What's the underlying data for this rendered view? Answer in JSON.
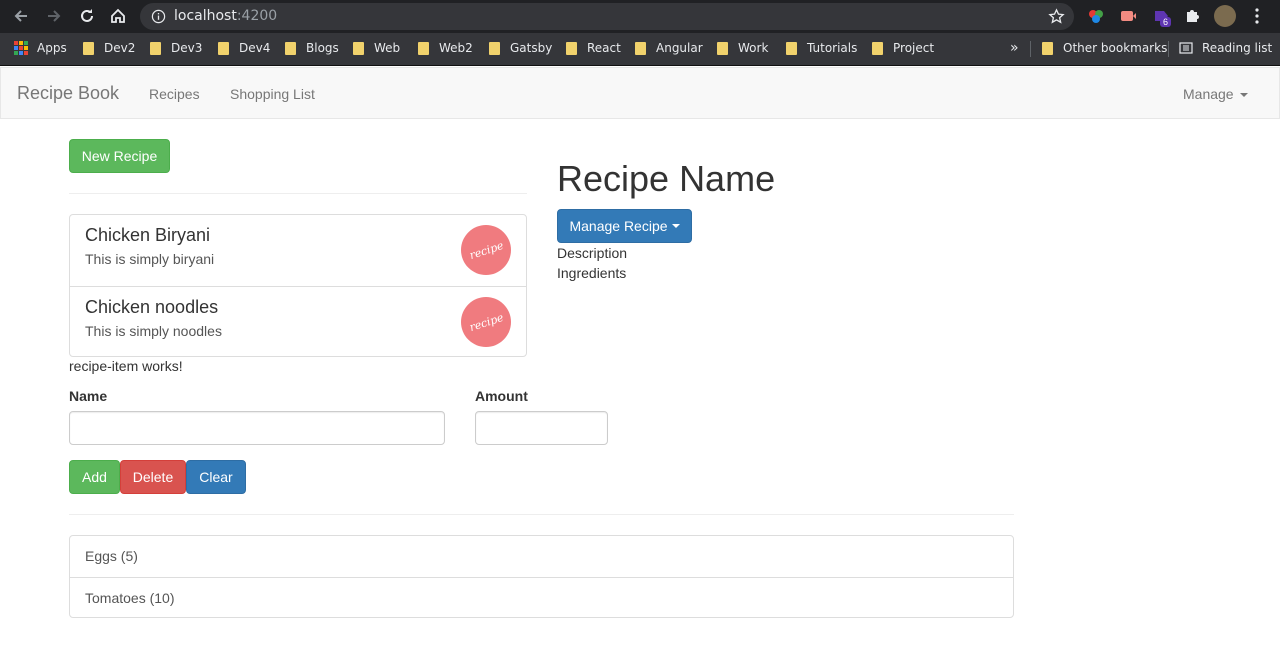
{
  "browser": {
    "url_host": "localhost",
    "url_port": ":4200",
    "bookmarks": [
      "Apps",
      "Dev2",
      "Dev3",
      "Dev4",
      "Blogs",
      "Web",
      "Web2",
      "Gatsby",
      "React",
      "Angular",
      "Work",
      "Tutorials",
      "Project"
    ],
    "overflow": "»",
    "other_bookmarks": "Other bookmarks",
    "reading_list": "Reading list",
    "extension_badge": "6"
  },
  "navbar": {
    "brand": "Recipe Book",
    "links": [
      "Recipes",
      "Shopping List"
    ],
    "manage": "Manage"
  },
  "recipes": {
    "new_button": "New Recipe",
    "items": [
      {
        "name": "Chicken Biryani",
        "description": "This is simply biryani",
        "image_text": "recipe"
      },
      {
        "name": "Chicken noodles",
        "description": "This is simply noodles",
        "image_text": "recipe"
      }
    ],
    "placeholder_text": "recipe-item works!"
  },
  "detail": {
    "title": "Recipe Name",
    "manage_button": "Manage Recipe",
    "description": "Description",
    "ingredients": "Ingredients"
  },
  "shopping_edit": {
    "name_label": "Name",
    "amount_label": "Amount",
    "name_value": "",
    "amount_value": "",
    "add": "Add",
    "delete": "Delete",
    "clear": "Clear"
  },
  "shopping_list": [
    {
      "text": "Eggs (5)"
    },
    {
      "text": "Tomatoes (10)"
    }
  ],
  "colors": {
    "success": "#5cb85c",
    "danger": "#d9534f",
    "primary": "#337ab7",
    "recipe_image": "#f07b7f",
    "chrome_dark": "#202124"
  }
}
